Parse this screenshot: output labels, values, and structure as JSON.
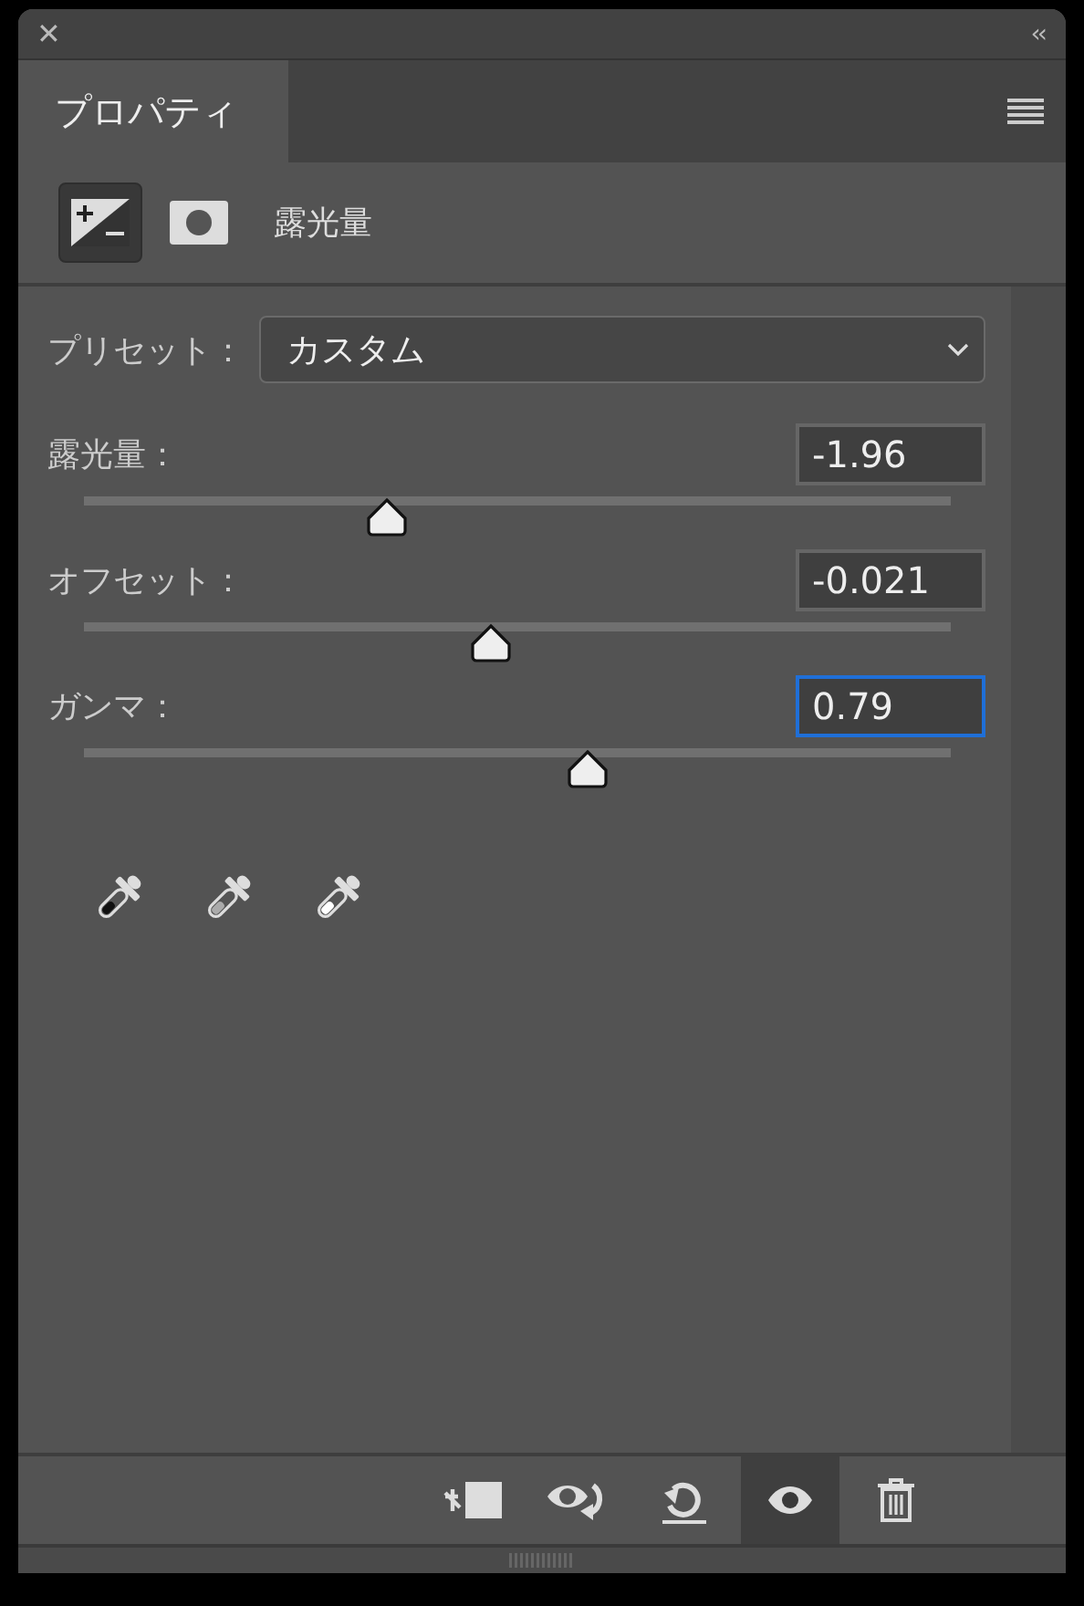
{
  "panel": {
    "close_glyph": "✕",
    "collapse_glyph": "‹‹"
  },
  "tabs": [
    {
      "label": "プロパティ",
      "selected": true
    }
  ],
  "header": {
    "views": [
      {
        "kind": "adjustment",
        "selected": true
      },
      {
        "kind": "mask",
        "selected": false
      }
    ],
    "title": "露光量"
  },
  "preset": {
    "label": "プリセット：",
    "value": "カスタム"
  },
  "sliders": [
    {
      "label": "露光量：",
      "value": "-1.96",
      "level": 0.35,
      "focused": false
    },
    {
      "label": "オフセット：",
      "value": "-0.021",
      "level": 0.47,
      "focused": false
    },
    {
      "label": "ガンマ：",
      "value": "0.79",
      "level": 0.58,
      "focused": true
    }
  ],
  "eyedroppers": [
    {
      "kind": "black"
    },
    {
      "kind": "gray"
    },
    {
      "kind": "white"
    }
  ],
  "footer": [
    {
      "kind": "clip",
      "selected": false
    },
    {
      "kind": "view-previous",
      "selected": false
    },
    {
      "kind": "reset",
      "selected": false
    },
    {
      "kind": "visibility",
      "selected": true
    },
    {
      "kind": "delete",
      "selected": false
    }
  ]
}
